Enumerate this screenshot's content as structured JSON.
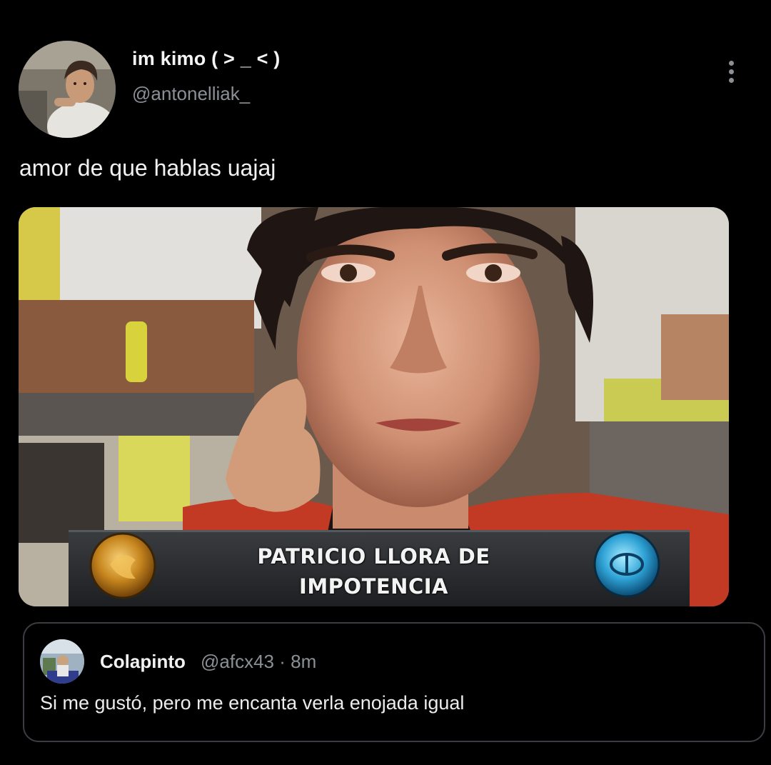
{
  "tweet": {
    "display_name": "im kimo ( > _ < )",
    "handle": "@antonelliak_",
    "text": "amor de que hablas uajaj",
    "menu_icon": "more-vertical-icon",
    "media": {
      "caption_line1": "PATRICIO LLORA DE",
      "caption_line2": "IMPOTENCIA"
    }
  },
  "quoted_tweet": {
    "display_name": "Colapinto",
    "meta": "@afcx43 · 8m",
    "text": "Si me gustó, pero me encanta verla enojada igual"
  },
  "colors": {
    "background": "#000000",
    "primary_text": "#e7e9ea",
    "secondary_text": "#8b9096",
    "quote_border": "#3a3d41"
  }
}
